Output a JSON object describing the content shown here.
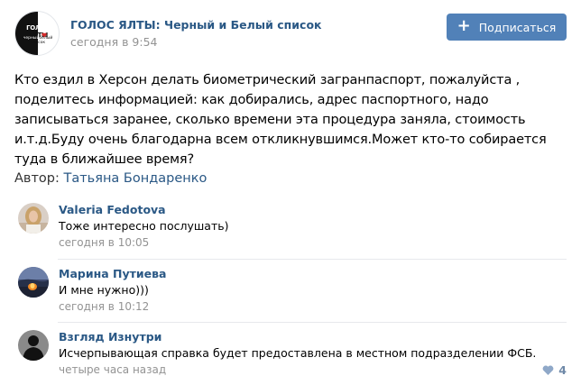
{
  "group": {
    "name": "ГОЛОС ЯЛТЫ: Черный и Белый список",
    "time": "сегодня в 9:54",
    "logo_title_left": "ГОЛОС",
    "logo_title_right": "ЯЛТЫ",
    "logo_sub_left": "черный",
    "logo_sub_right": "белый",
    "logo_sub_bottom": "список"
  },
  "subscribe": {
    "label": "Подписаться",
    "icon": "plus-icon"
  },
  "post": {
    "text": "Кто ездил в Херсон делать биометрический загранпаспорт, пожалуйста , поделитесь информацией: как добирались, адрес паспортного, надо записываться заранее, сколько времени эта процедура заняла, стоимость и.т.д.Буду очень благодарна всем откликнувшимся.Может кто-то собирается туда в ближайшее время?",
    "author_label": "Автор:",
    "author_name": "Татьяна Бондаренко"
  },
  "comments": [
    {
      "name": "Valeria Fedotova",
      "text": "Тоже интересно послушать)",
      "time": "сегодня в 10:05"
    },
    {
      "name": "Марина Путиева",
      "text": "И мне нужно)))",
      "time": "сегодня в 10:12"
    },
    {
      "name": "Взгляд Изнутри",
      "text": "Исчерпывающая справка будет предоставлена в местном подразделении ФСБ.",
      "time": "четыре часа назад",
      "likes": "4"
    }
  ],
  "colors": {
    "link": "#2a5885",
    "button": "#5181b8",
    "muted": "#939393",
    "like": "#6f89a8"
  }
}
